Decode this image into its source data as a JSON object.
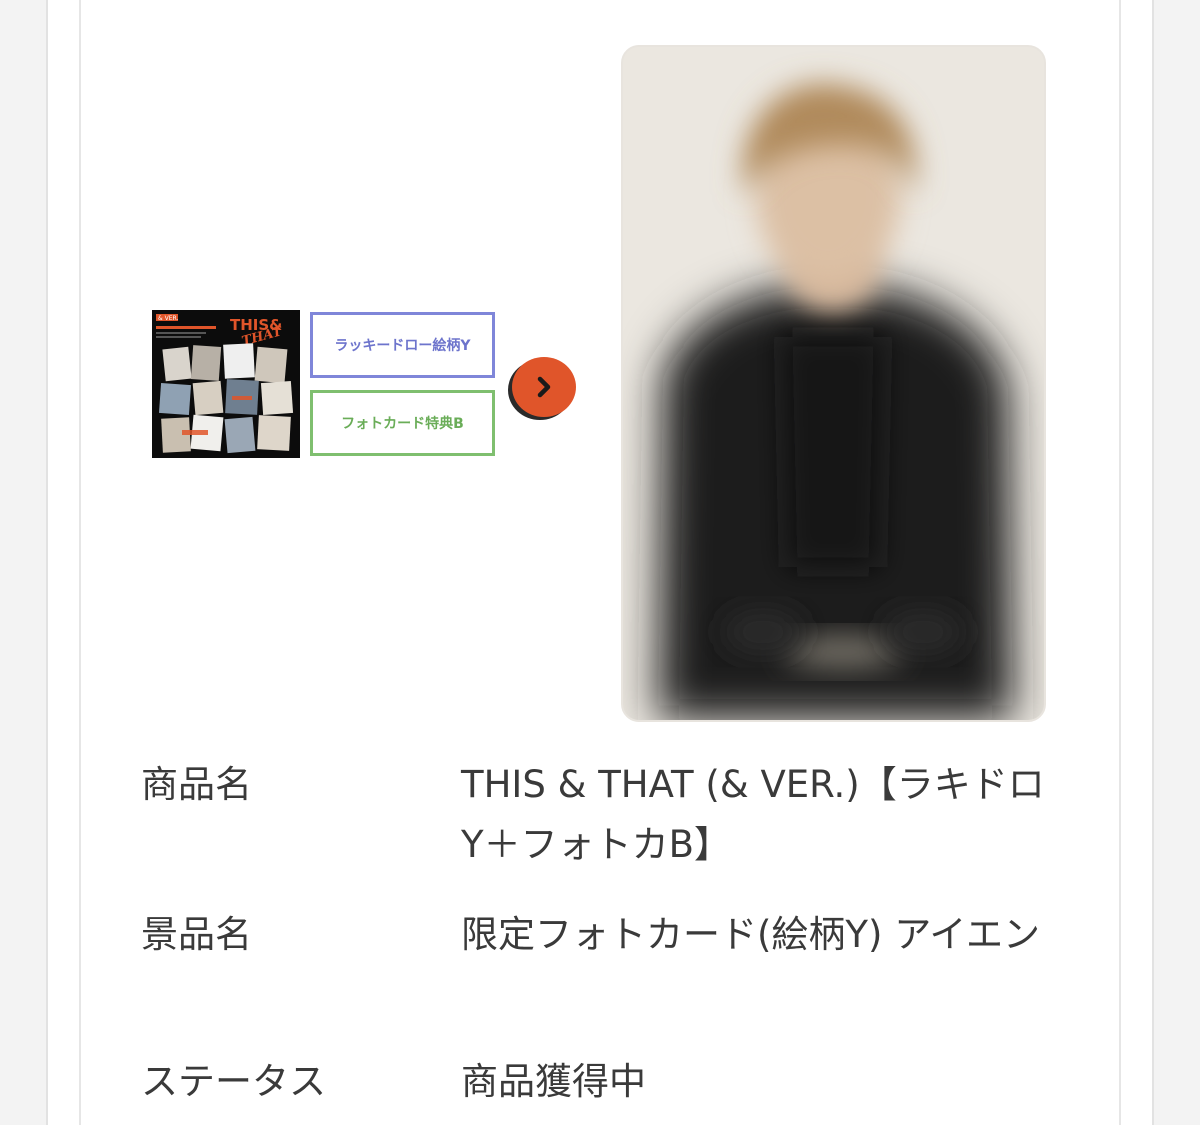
{
  "product": {
    "album_art": {
      "title_text": "THIS&",
      "title_text2": "THAT",
      "version_text": "& VER."
    },
    "tag_lucky_draw": "ラッキードロー絵柄Y",
    "tag_photocard": "フォトカード特典B",
    "next_icon": "chevron-right-icon"
  },
  "details": [
    {
      "label": "商品名",
      "value": "THIS & THAT (& VER.)【ラキドロY＋フォトカB】"
    },
    {
      "label": "景品名",
      "value": "限定フォトカード(絵柄Y) アイエン"
    },
    {
      "label": "ステータス",
      "value": "商品獲得中"
    }
  ],
  "colors": {
    "tag_y_border": "#7f86d9",
    "tag_b_border": "#7fbf6f",
    "arrow_button": "#e0552a"
  }
}
